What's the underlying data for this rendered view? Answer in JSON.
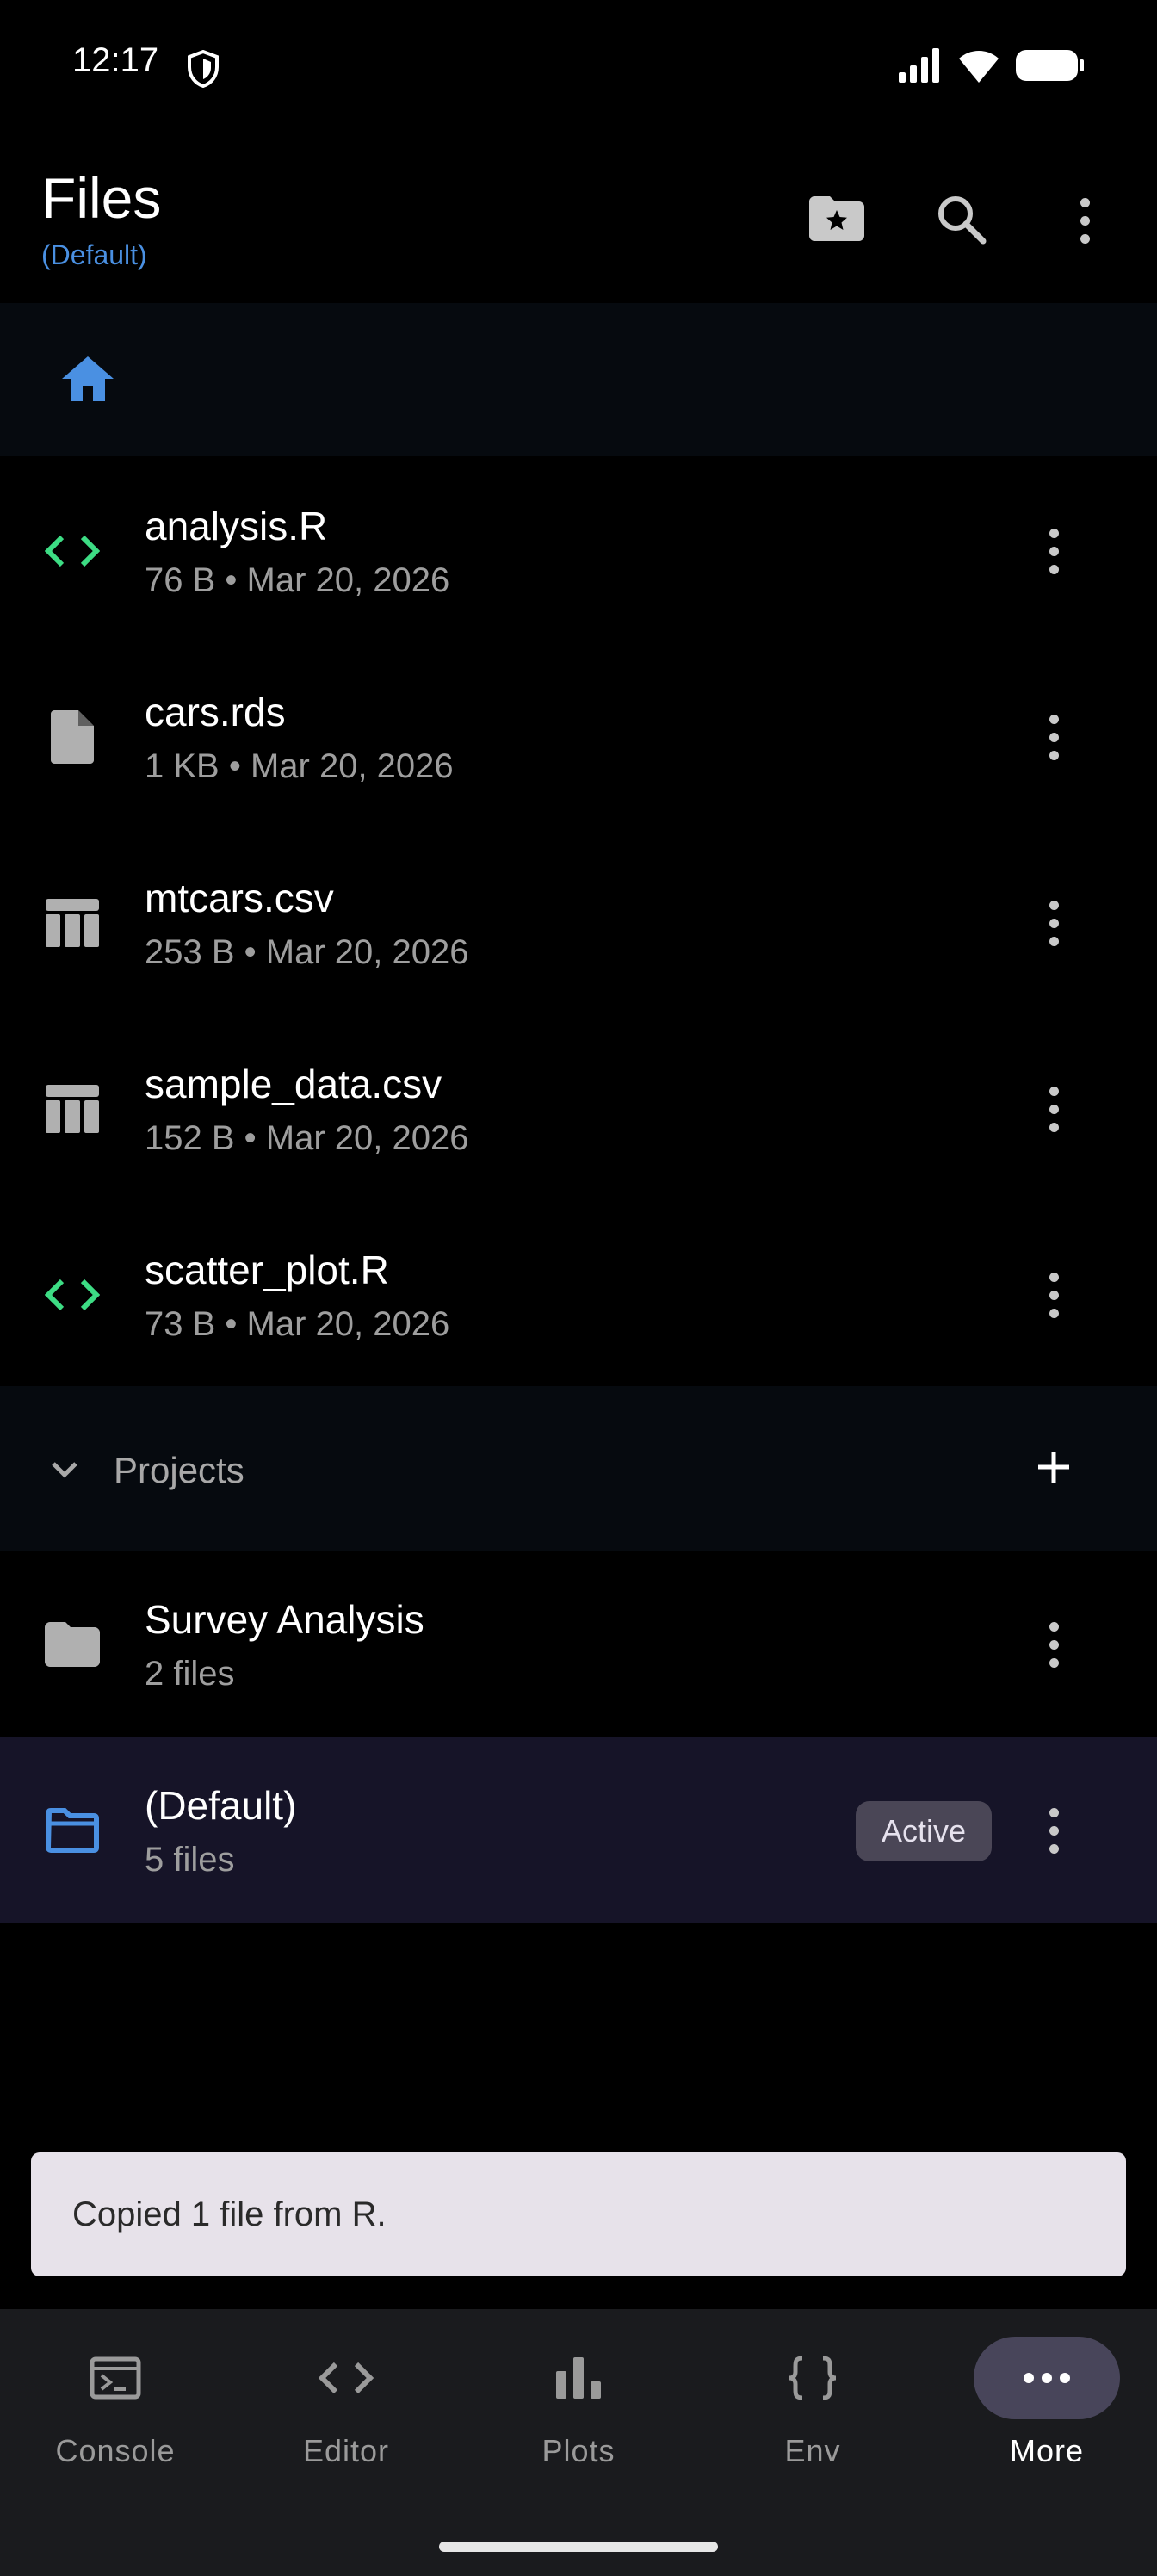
{
  "status_bar": {
    "time": "12:17"
  },
  "app_bar": {
    "title": "Files",
    "subtitle": "(Default)",
    "actions": [
      "bookmark-folder-icon",
      "search-icon",
      "more-vert-icon"
    ]
  },
  "breadcrumb": {
    "icon": "home-icon",
    "icon_color": "#4a90e2"
  },
  "files": [
    {
      "name": "analysis.R",
      "meta": "76 B • Mar 20, 2026",
      "icon": "code-icon",
      "icon_color": "#3ddc84"
    },
    {
      "name": "cars.rds",
      "meta": "1 KB • Mar 20, 2026",
      "icon": "file-icon",
      "icon_color": "#b0b0b0"
    },
    {
      "name": "mtcars.csv",
      "meta": "253 B • Mar 20, 2026",
      "icon": "table-icon",
      "icon_color": "#b0b0b0"
    },
    {
      "name": "sample_data.csv",
      "meta": "152 B • Mar 20, 2026",
      "icon": "table-icon",
      "icon_color": "#b0b0b0"
    },
    {
      "name": "scatter_plot.R",
      "meta": "73 B • Mar 20, 2026",
      "icon": "code-icon",
      "icon_color": "#3ddc84"
    }
  ],
  "projects": {
    "label": "Projects",
    "items": [
      {
        "name": "Survey Analysis",
        "meta": "2 files",
        "active": false
      },
      {
        "name": "(Default)",
        "meta": "5 files",
        "active": true,
        "badge": "Active"
      }
    ]
  },
  "snackbar": {
    "message": "Copied 1 file from R."
  },
  "bottom_nav": {
    "items": [
      {
        "label": "Console",
        "icon": "terminal-icon"
      },
      {
        "label": "Editor",
        "icon": "code-icon"
      },
      {
        "label": "Plots",
        "icon": "bar-chart-icon"
      },
      {
        "label": "Env",
        "icon": "braces-icon"
      },
      {
        "label": "More",
        "icon": "more-horiz-icon",
        "selected": true
      }
    ]
  },
  "colors": {
    "background": "#000000",
    "accent_blue": "#4a90e2",
    "code_green": "#3ddc84",
    "active_row": "#161428",
    "snackbar": "#e7e2ea"
  }
}
